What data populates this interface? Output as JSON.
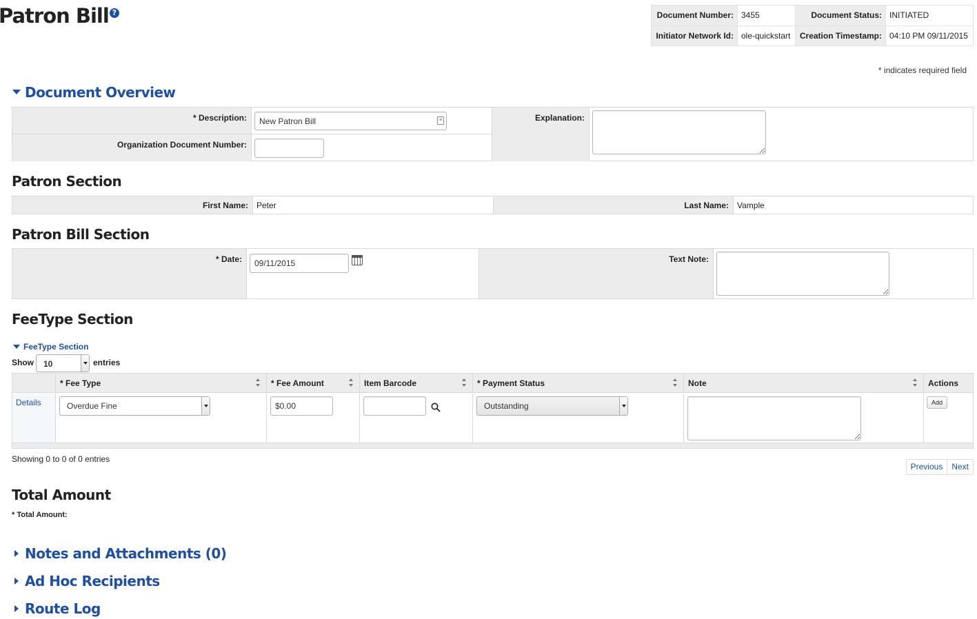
{
  "page": {
    "title": "Patron Bill",
    "help_icon": "?",
    "required_note": "* indicates required field"
  },
  "doc_header": {
    "doc_number_label": "Document Number:",
    "doc_number": "3455",
    "doc_status_label": "Document Status:",
    "doc_status": "INITIATED",
    "initiator_label": "Initiator Network Id:",
    "initiator": "ole-quickstart",
    "creation_label": "Creation Timestamp:",
    "creation": "04:10 PM 09/11/2015"
  },
  "overview": {
    "title": "Document Overview",
    "description_label": "* Description:",
    "description_value": "New Patron Bill",
    "org_doc_label": "Organization Document Number:",
    "org_doc_value": "",
    "explanation_label": "Explanation:",
    "explanation_value": ""
  },
  "patron": {
    "title": "Patron Section",
    "first_name_label": "First Name:",
    "first_name": "Peter",
    "last_name_label": "Last Name:",
    "last_name": "Vample"
  },
  "bill": {
    "title": "Patron Bill Section",
    "date_label": "* Date:",
    "date_value": "09/11/2015",
    "text_note_label": "Text Note:",
    "text_note_value": ""
  },
  "feetype": {
    "title": "FeeType Section",
    "subsection_title": "FeeType Section",
    "show_label": "Show",
    "show_value": "10",
    "entries_label": "entries",
    "columns": {
      "fee_type": "* Fee Type",
      "fee_amount": "* Fee Amount",
      "item_barcode": "Item Barcode",
      "payment_status": "* Payment Status",
      "note": "Note",
      "actions": "Actions"
    },
    "row": {
      "details_link": "Details",
      "fee_type": "Overdue Fine",
      "fee_amount": "$0.00",
      "item_barcode": "",
      "payment_status": "Outstanding",
      "note": "",
      "add_button": "Add"
    },
    "showing": "Showing 0 to 0 of 0 entries",
    "prev": "Previous",
    "next": "Next"
  },
  "total": {
    "title": "Total Amount",
    "label": "* Total Amount:"
  },
  "collapsed_sections": {
    "notes": "Notes and Attachments (0)",
    "adhoc": "Ad Hoc Recipients",
    "route": "Route Log"
  },
  "colors": {
    "link": "#1e4fa3",
    "label_bg": "#ececec",
    "border": "#d9d9d9"
  }
}
